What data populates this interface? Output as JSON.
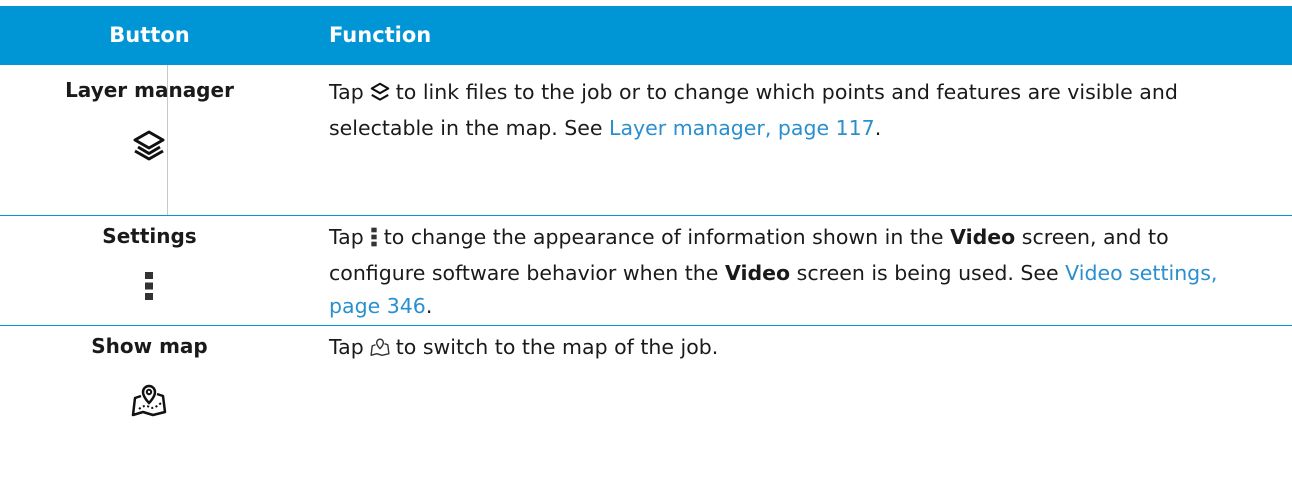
{
  "header": {
    "col_button": "Button",
    "col_function": "Function"
  },
  "rows": [
    {
      "button_name": "Layer manager",
      "icon": "layers-icon",
      "desc_prefix": "Tap",
      "desc_main": "to link files to the job or to change which points and features are visible and selectable in the map. See",
      "link_text": "Layer manager, page 117",
      "desc_suffix": "."
    },
    {
      "button_name": "Settings",
      "icon": "more-vertical-icon",
      "desc_prefix": "Tap",
      "desc_part1": "to change the appearance of information shown in the",
      "bold1": "Video",
      "desc_part2": "screen, and to configure software behavior when the",
      "bold2": "Video",
      "desc_part3": "screen is being used. See",
      "link_text": "Video settings, page 346",
      "desc_suffix": "."
    },
    {
      "button_name": "Show map",
      "icon": "map-pin-icon",
      "desc_prefix": "Tap",
      "desc_main": "to switch to the map of the job."
    }
  ]
}
